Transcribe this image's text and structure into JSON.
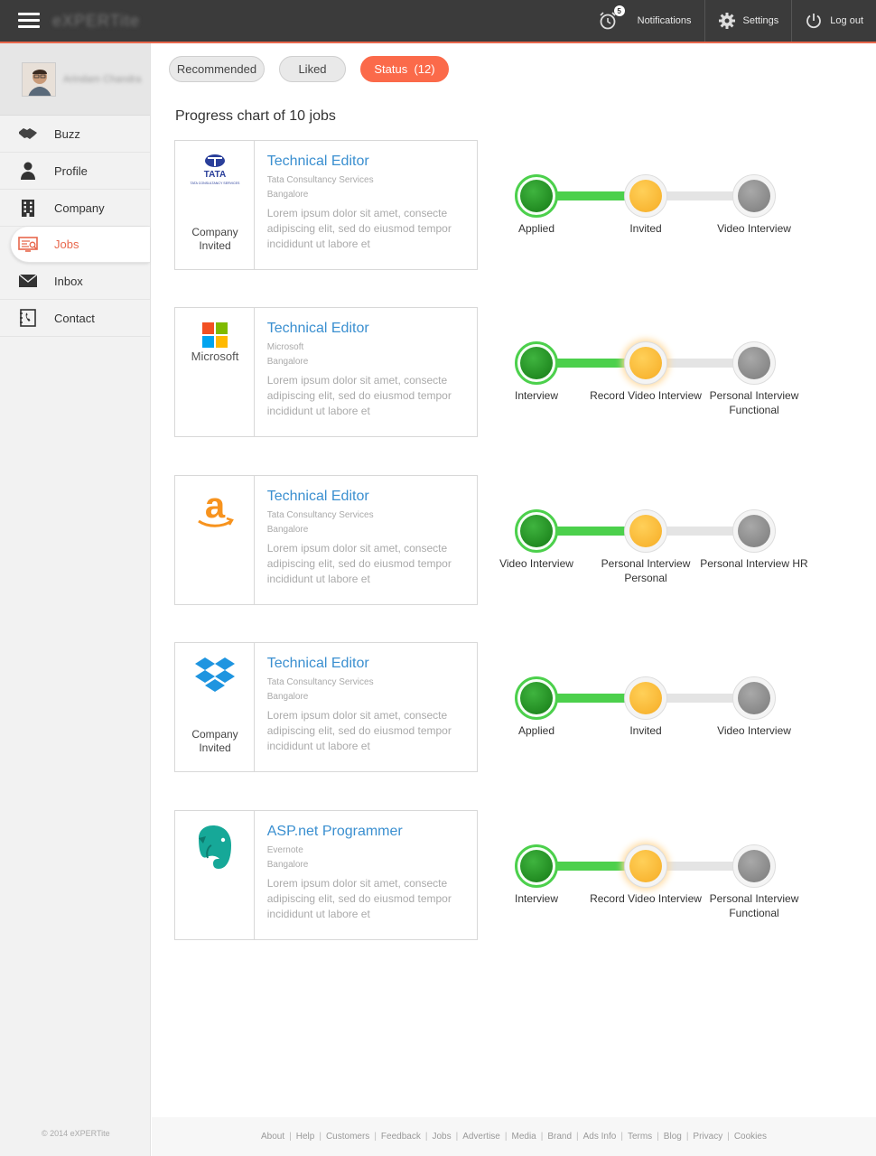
{
  "header": {
    "brand": "eXPERTite",
    "notification_count": "5",
    "notifications_label": "Notifications",
    "settings_label": "Settings",
    "logout_label": "Log out"
  },
  "sidebar": {
    "user_name": "Arindam Chandra",
    "items": [
      {
        "label": "Buzz",
        "icon": "handshake-icon"
      },
      {
        "label": "Profile",
        "icon": "person-icon"
      },
      {
        "label": "Company",
        "icon": "building-icon"
      },
      {
        "label": "Jobs",
        "icon": "monitor-icon"
      },
      {
        "label": "Inbox",
        "icon": "envelope-icon"
      },
      {
        "label": "Contact",
        "icon": "phonebook-icon"
      }
    ],
    "active": "Jobs",
    "footer": "© 2014 eXPERTite"
  },
  "tabs": [
    {
      "label": "Recommended"
    },
    {
      "label": "Liked"
    },
    {
      "label": "Status  (12)"
    }
  ],
  "page_title": "Progress chart of 10 jobs",
  "jobs": [
    {
      "logo": "tata",
      "logo_caption": "Company Invited",
      "title": "Technical Editor",
      "company": "Tata Consultancy Services",
      "location": "Bangalore",
      "description": "Lorem ipsum dolor sit amet, consecte adipiscing elit, sed do eiusmod tempor incididunt ut labore et",
      "stages": [
        "Applied",
        "Invited",
        "Video Interview"
      ]
    },
    {
      "logo": "microsoft",
      "logo_caption": "",
      "title": "Technical Editor",
      "company": "Microsoft",
      "location": "Bangalore",
      "description": "Lorem ipsum dolor sit amet, consecte adipiscing elit, sed do eiusmod tempor incididunt ut labore et",
      "stages": [
        "Interview",
        "Record Video Interview",
        "Personal Interview Functional"
      ]
    },
    {
      "logo": "amazon",
      "logo_caption": "",
      "title": "Technical Editor",
      "company": "Tata Consultancy Services",
      "location": "Bangalore",
      "description": "Lorem ipsum dolor sit amet, consecte adipiscing elit, sed do eiusmod tempor incididunt ut labore et",
      "stages": [
        "Video Interview",
        "Personal Interview Personal",
        "Personal Interview HR"
      ]
    },
    {
      "logo": "dropbox",
      "logo_caption": "Company Invited",
      "title": "Technical Editor",
      "company": "Tata Consultancy Services",
      "location": "Bangalore",
      "description": "Lorem ipsum dolor sit amet, consecte adipiscing elit, sed do eiusmod tempor incididunt ut labore et",
      "stages": [
        "Applied",
        "Invited",
        "Video Interview"
      ]
    },
    {
      "logo": "evernote",
      "logo_caption": "",
      "title": "ASP.net Programmer",
      "company": "Evernote",
      "location": "Bangalore",
      "description": "Lorem ipsum dolor sit amet, consecte adipiscing elit, sed do eiusmod tempor incididunt ut labore et",
      "stages": [
        "Interview",
        "Record Video Interview",
        "Personal Interview Functional"
      ]
    }
  ],
  "footer_links": [
    "About",
    "Help",
    "Customers",
    "Feedback",
    "Jobs",
    "Advertise",
    "Media",
    "Brand",
    "Ads Info",
    "Terms",
    "Blog",
    "Privacy",
    "Cookies"
  ],
  "colors": {
    "accent": "#fb6a4a",
    "link": "#3a8fd0",
    "stage_done": "#4cd04c",
    "stage_current": "#f6ac24",
    "stage_pending": "#8a8a8a",
    "topbar": "#3b3b3b"
  }
}
